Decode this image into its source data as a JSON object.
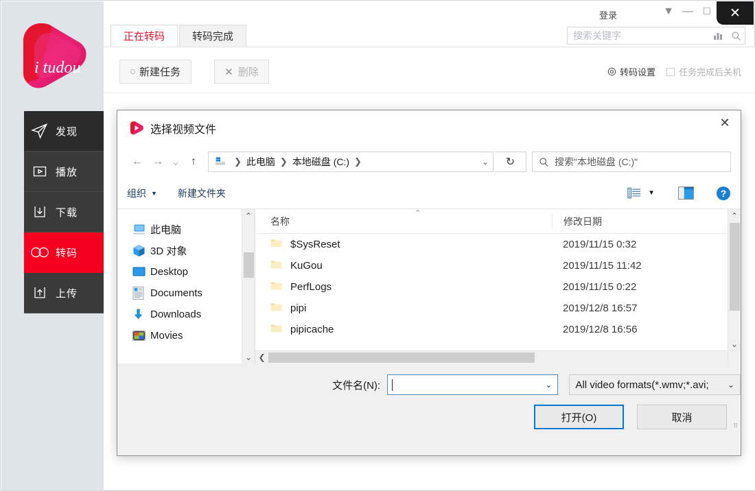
{
  "app": {
    "brand": "i tudou",
    "login_label": "登录",
    "window_controls": {
      "dropdown": "▼",
      "minimize": "—",
      "maximize": "□",
      "close": "✕"
    },
    "search": {
      "placeholder": "搜索关键字",
      "value": "",
      "chart_icon": "chart-icon",
      "search_icon": "search-icon"
    },
    "tabs": [
      {
        "label": "正在转码",
        "active": true
      },
      {
        "label": "转码完成",
        "active": false
      }
    ],
    "toolbar": {
      "new_task_label": "新建任务",
      "delete_label": "删除",
      "settings_label": "转码设置",
      "shutdown_label": "任务完成后关机",
      "shutdown_checked": false
    },
    "sidebar": {
      "items": [
        {
          "label": "发现",
          "icon": "send-icon",
          "active": false
        },
        {
          "label": "播放",
          "icon": "play-icon",
          "active": false
        },
        {
          "label": "下载",
          "icon": "download-icon",
          "active": false
        },
        {
          "label": "转码",
          "icon": "transcode-icon",
          "active": true
        },
        {
          "label": "上传",
          "icon": "upload-icon",
          "active": false
        }
      ]
    },
    "accent_color": "#f5001e",
    "tab_active_color": "#e8112d"
  },
  "dialog": {
    "title": "选择视频文件",
    "close_label": "✕",
    "nav": {
      "back": "←",
      "forward": "→",
      "history": "⌄",
      "up": "↑",
      "refresh": "↻",
      "breadcrumbs": [
        "此电脑",
        "本地磁盘 (C:)"
      ],
      "address_caret": "⌄",
      "search_placeholder": "搜索\"本地磁盘 (C:)\""
    },
    "commands": {
      "organize": "组织",
      "new_folder": "新建文件夹",
      "view_icon": "list-view-icon",
      "pane_icon": "preview-pane-icon",
      "help_icon": "help-icon"
    },
    "tree": {
      "items": [
        {
          "label": "此电脑",
          "icon": "computer-icon"
        },
        {
          "label": "3D 对象",
          "icon": "3d-objects-icon"
        },
        {
          "label": "Desktop",
          "icon": "desktop-icon"
        },
        {
          "label": "Documents",
          "icon": "documents-icon"
        },
        {
          "label": "Downloads",
          "icon": "downloads-icon"
        },
        {
          "label": "Movies",
          "icon": "movies-icon"
        }
      ]
    },
    "list": {
      "columns": [
        "名称",
        "修改日期"
      ],
      "rows": [
        {
          "name": "$SysReset",
          "date": "2019/11/15 0:32"
        },
        {
          "name": "KuGou",
          "date": "2019/11/15 11:42"
        },
        {
          "name": "PerfLogs",
          "date": "2019/11/15 0:22"
        },
        {
          "name": "pipi",
          "date": "2019/12/8 16:57"
        },
        {
          "name": "pipicache",
          "date": "2019/12/8 16:56"
        }
      ]
    },
    "footer": {
      "filename_label": "文件名(N):",
      "filename_value": "",
      "filter_value": "All video formats(*.wmv;*.avi;",
      "open_label": "打开(O)",
      "cancel_label": "取消"
    }
  }
}
